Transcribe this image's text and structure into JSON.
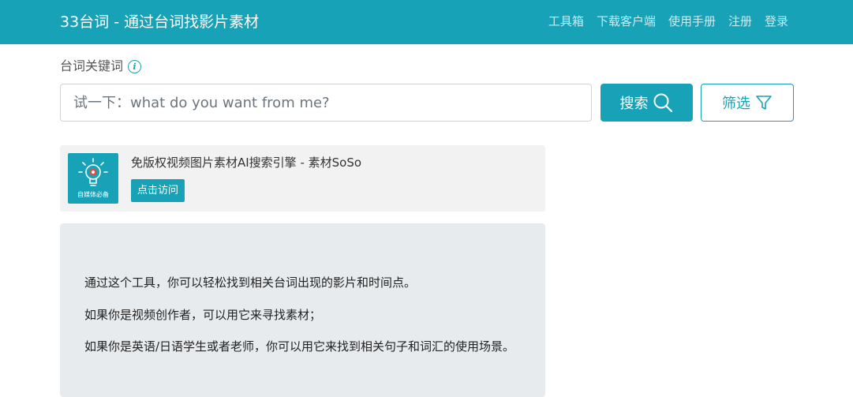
{
  "header": {
    "title": "33台词 - 通过台词找影片素材",
    "nav": [
      "工具箱",
      "下载客户端",
      "使用手册",
      "注册",
      "登录"
    ]
  },
  "search": {
    "label": "台词关键词",
    "placeholder": "试一下：what do you want from me?",
    "submit_label": "搜索",
    "filter_label": "筛选"
  },
  "ad": {
    "title": "免版权视频图片素材AI搜索引擎 - 素材SoSo",
    "logo_caption": "自媒体必备",
    "button_label": "点击访问"
  },
  "intro": {
    "lines": [
      "通过这个工具，你可以轻松找到相关台词出现的影片和时间点。",
      "如果你是视频创作者，可以用它来寻找素材；",
      "如果你是英语/日语学生或者老师，你可以用它来找到相关句子和词汇的使用场景。"
    ]
  },
  "colors": {
    "brand": "#17a2b8",
    "intro_bg": "#e8ebee",
    "ad_bg": "#f2f2f2"
  }
}
